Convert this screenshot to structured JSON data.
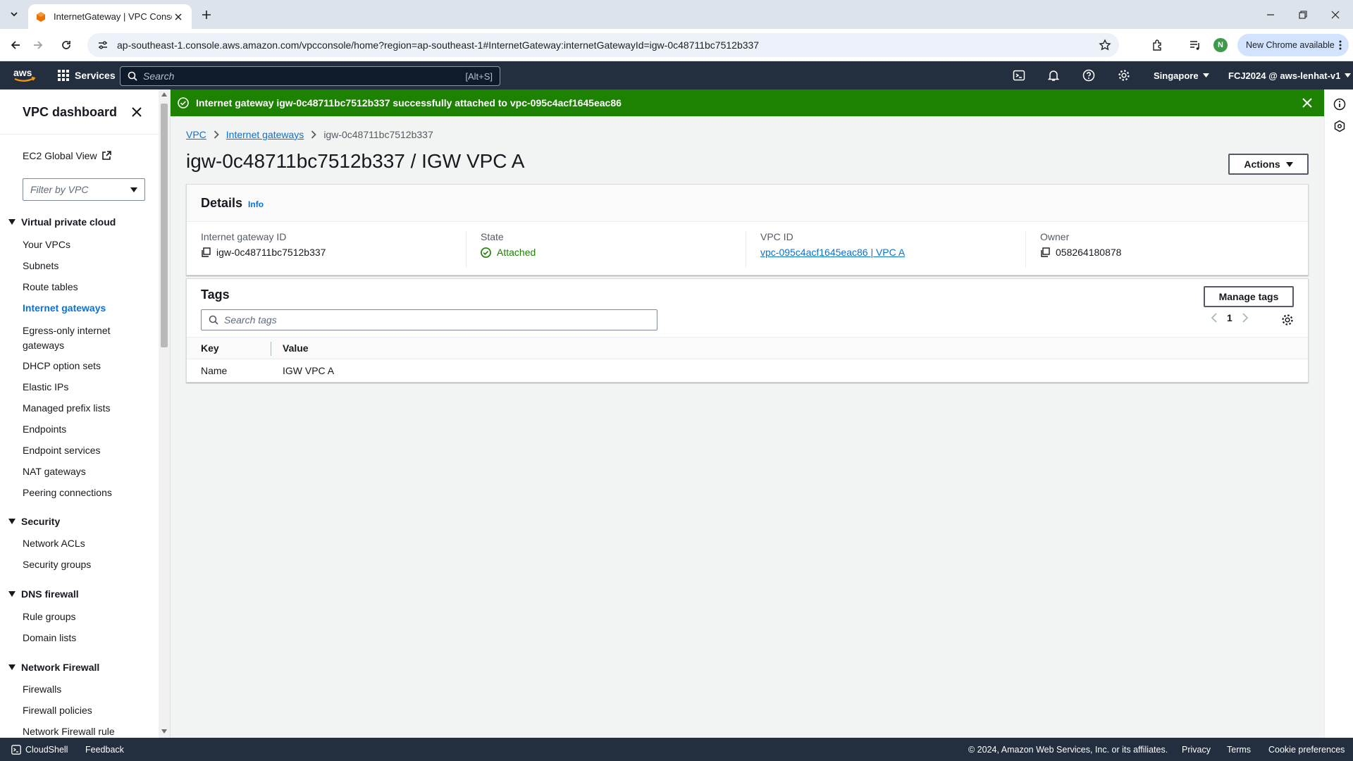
{
  "browser": {
    "tab_title": "InternetGateway | VPC Console",
    "url": "ap-southeast-1.console.aws.amazon.com/vpcconsole/home?region=ap-southeast-1#InternetGateway:internetGatewayId=igw-0c48711bc7512b337",
    "profile_initial": "N",
    "update_label": "New Chrome available"
  },
  "aws_nav": {
    "logo_text": "aws",
    "services_label": "Services",
    "search_placeholder": "Search",
    "search_shortcut": "[Alt+S]",
    "region": "Singapore",
    "account": "FCJ2024 @ aws-lenhat-v1"
  },
  "sidebar": {
    "title": "VPC dashboard",
    "ec2_global_view": "EC2 Global View",
    "filter_placeholder": "Filter by VPC",
    "sections": [
      {
        "label": "Virtual private cloud",
        "items": [
          "Your VPCs",
          "Subnets",
          "Route tables",
          "Internet gateways",
          "Egress-only internet gateways",
          "DHCP option sets",
          "Elastic IPs",
          "Managed prefix lists",
          "Endpoints",
          "Endpoint services",
          "NAT gateways",
          "Peering connections"
        ]
      },
      {
        "label": "Security",
        "items": [
          "Network ACLs",
          "Security groups"
        ]
      },
      {
        "label": "DNS firewall",
        "items": [
          "Rule groups",
          "Domain lists"
        ]
      },
      {
        "label": "Network Firewall",
        "items": [
          "Firewalls",
          "Firewall policies",
          "Network Firewall rule"
        ]
      }
    ],
    "active_item": "Internet gateways"
  },
  "flash": {
    "message": "Internet gateway igw-0c48711bc7512b337 successfully attached to vpc-095c4acf1645eac86"
  },
  "breadcrumb": {
    "vpc": "VPC",
    "igws": "Internet gateways",
    "current": "igw-0c48711bc7512b337"
  },
  "page": {
    "title": "igw-0c48711bc7512b337 / IGW VPC A",
    "actions_label": "Actions"
  },
  "details": {
    "heading": "Details",
    "info": "Info",
    "igw_id_label": "Internet gateway ID",
    "igw_id": "igw-0c48711bc7512b337",
    "state_label": "State",
    "state": "Attached",
    "vpc_id_label": "VPC ID",
    "vpc_id": "vpc-095c4acf1645eac86 | VPC A",
    "owner_label": "Owner",
    "owner": "058264180878"
  },
  "tags": {
    "heading": "Tags",
    "manage_label": "Manage tags",
    "search_placeholder": "Search tags",
    "page": "1",
    "columns": {
      "key": "Key",
      "value": "Value"
    },
    "rows": [
      {
        "key": "Name",
        "value": "IGW VPC A"
      }
    ]
  },
  "footer": {
    "cloudshell": "CloudShell",
    "feedback": "Feedback",
    "copyright": "© 2024, Amazon Web Services, Inc. or its affiliates.",
    "privacy": "Privacy",
    "terms": "Terms",
    "cookies": "Cookie preferences"
  },
  "colors": {
    "success_green": "#1d8102",
    "aws_navy": "#232f3e",
    "link_blue": "#0972d3",
    "aws_orange": "#ff9900"
  }
}
